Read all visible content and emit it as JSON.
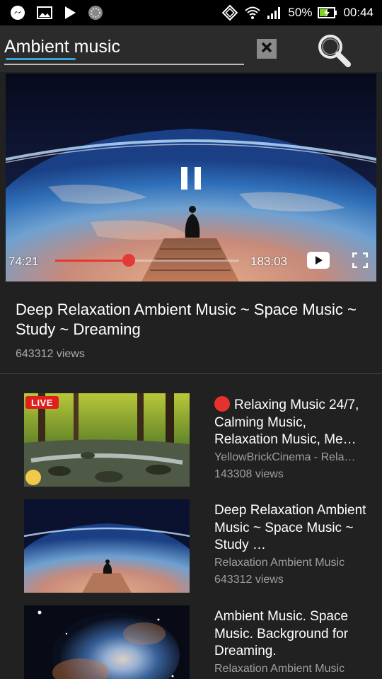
{
  "status_bar": {
    "battery_percent": "50%",
    "time": "00:44",
    "icons": [
      "messenger-icon",
      "image-icon",
      "play-store-icon",
      "dots-icon",
      "rotate-icon",
      "wifi-icon",
      "signal-icon",
      "battery-charging-icon"
    ]
  },
  "search": {
    "query": "Ambient music",
    "clear_icon": "close-icon",
    "search_icon": "search-icon"
  },
  "player": {
    "current_time": "74:21",
    "duration": "183:03",
    "progress": 0.4,
    "icons": [
      "pause-icon",
      "youtube-icon",
      "fullscreen-icon"
    ]
  },
  "now_playing": {
    "title": "Deep Relaxation Ambient Music ~ Space Music ~ Study ~ Dreaming",
    "views": "643312 views"
  },
  "related": [
    {
      "badge": "LIVE",
      "title": "Relaxing Music 24/7, Calming Music, Relaxation Music, Me…",
      "channel": "YellowBrickCinema - Rela…",
      "views": "143308 views"
    },
    {
      "title": "Deep Relaxation Ambient Music ~ Space Music ~ Study …",
      "channel": "Relaxation Ambient Music",
      "views": "643312 views"
    },
    {
      "title": "Ambient Music. Space Music. Background for Dreaming.",
      "channel": "Relaxation Ambient Music",
      "views": ""
    }
  ],
  "colors": {
    "accent_red": "#e53935",
    "search_underline": "#3aa5d8",
    "background": "#212121"
  }
}
